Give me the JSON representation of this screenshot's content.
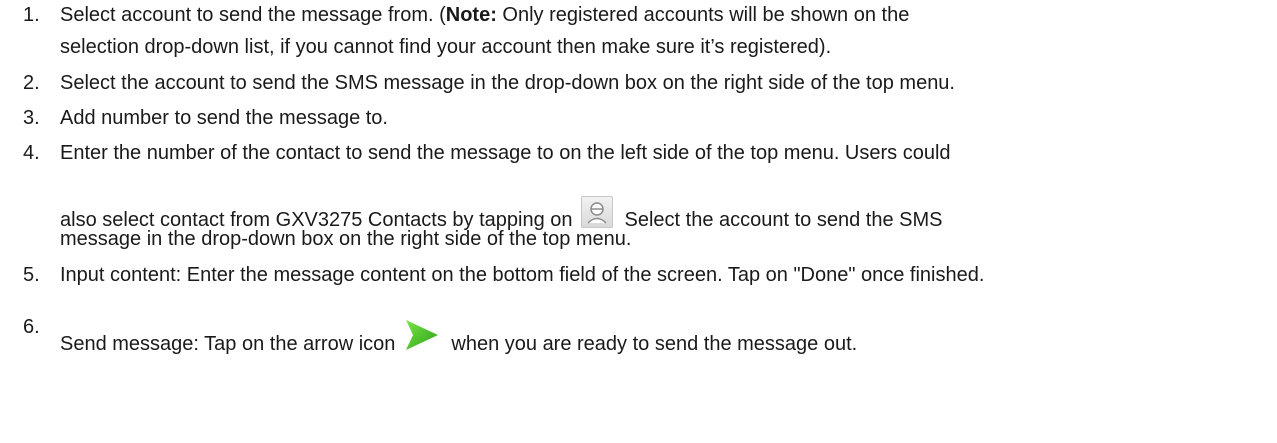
{
  "items": [
    {
      "number": "1.",
      "line1_pre": "Select account to send the message from. (",
      "line1_bold": "Note:",
      "line1_post": " Only registered accounts will be shown on the",
      "line2": "selection drop-down list, if you cannot find your account then make sure it’s registered)."
    },
    {
      "number": "2.",
      "text": "Select the account to send the SMS message in the drop-down box on the right side of the top menu."
    },
    {
      "number": "3.",
      "text": "Add number to send the message to."
    },
    {
      "number": "4.",
      "line1": "Enter the number of the contact to send the message to on the left side of the top menu. Users could",
      "line2_pre": "also select contact from GXV3275 Contacts by tapping on",
      "line2_post": "Select the account to send the SMS",
      "line3": "message in the drop-down box on the right side of the top menu."
    },
    {
      "number": "5.",
      "text": "Input content: Enter the message content on the bottom field of the screen. Tap on \"Done\" once finished."
    },
    {
      "number": "6.",
      "pre": "Send message: Tap on the arrow icon",
      "post": "when you are ready to send the message out."
    }
  ],
  "icons": {
    "contact": "contact-avatar-icon",
    "send": "send-arrow-icon",
    "send_color": "#3fbf1f"
  }
}
